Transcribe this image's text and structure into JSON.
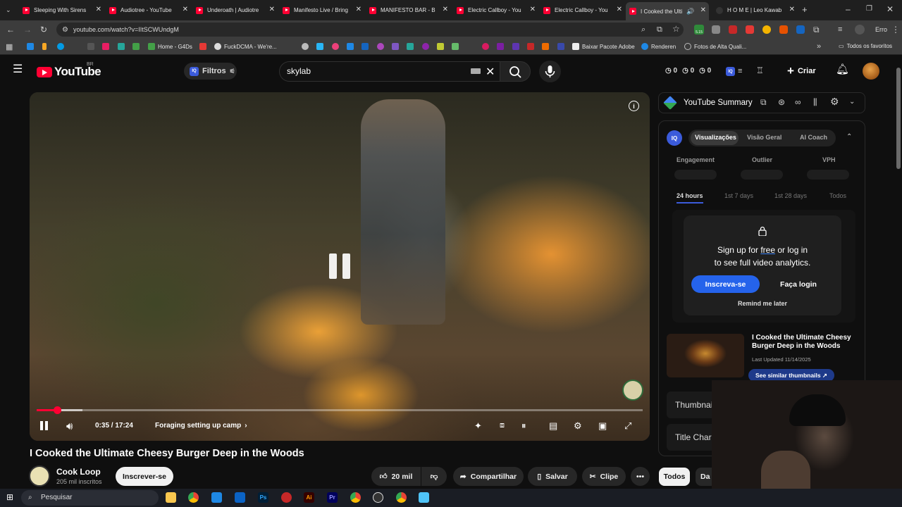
{
  "browser": {
    "tabs": [
      {
        "label": "Sleeping With Sirens",
        "icon": "youtube-favicon"
      },
      {
        "label": "Audiotree - YouTube",
        "icon": "youtube-favicon"
      },
      {
        "label": "Underoath | Audiotre",
        "icon": "youtube-favicon"
      },
      {
        "label": "Manifesto Live / Bring",
        "icon": "youtube-favicon"
      },
      {
        "label": "MANIFESTO BAR - B",
        "icon": "youtube-favicon"
      },
      {
        "label": "Electric Callboy - You",
        "icon": "youtube-favicon"
      },
      {
        "label": "Electric Callboy - You",
        "icon": "youtube-favicon"
      },
      {
        "label": "I Cooked the Ulti",
        "icon": "youtube-favicon"
      },
      {
        "label": "H O M E | Leo Kawab",
        "icon": "page-favicon"
      }
    ],
    "url": "youtube.com/watch?v=IItSCWUndgM",
    "profile_label": "Erro",
    "extension_badge": "5.15",
    "bookmarks": {
      "home": "Home - G4Ds",
      "fuck": "FuckDCMA - We're...",
      "baixar": "Baixar Pacote Adobe",
      "renderen": "Renderen",
      "fotos": "Fotos de Alta Quali...",
      "todos": "Todos os favoritos"
    }
  },
  "youtube": {
    "logo_text": "YouTube",
    "country_code": "BR",
    "filtros_label": "Filtros",
    "filtros_badge": "IQ",
    "search_value": "skylab",
    "counters": [
      "0",
      "0",
      "0"
    ],
    "create_label": "Criar"
  },
  "player": {
    "time": "0:35 / 17:24",
    "chapter": "Foraging setting up camp",
    "progress_fraction": 0.034,
    "buffer_fraction": 0.075
  },
  "video": {
    "title": "I Cooked the Ultimate Cheesy Burger Deep in the Woods",
    "channel": "Cook Loop",
    "subscribers": "205 mil inscritos",
    "subscribe_label": "Inscrever-se",
    "likes": "20 mil",
    "share_label": "Compartilhar",
    "save_label": "Salvar",
    "clip_label": "Clipe"
  },
  "sidebar": {
    "summary_title": "YouTube Summary",
    "iq_logo": "IQ",
    "segments": [
      "Visualizações",
      "Visão Geral",
      "AI Coach"
    ],
    "metrics": [
      "Engagement",
      "Outlier",
      "VPH"
    ],
    "time_ranges": [
      "24 hours",
      "1st 7 days",
      "1st 28 days",
      "Todos"
    ],
    "locked_line1_a": "Sign up for ",
    "locked_line1_free": "free",
    "locked_line1_b": " or log in",
    "locked_line2": "to see full video analytics.",
    "signup_button": "Inscreva-se",
    "login_button": "Faça login",
    "remind_label": "Remind me later",
    "thumb_title": "I Cooked the Ultimate Cheesy Burger Deep in the Woods",
    "thumb_date": "Last Updated 11/14/2025",
    "thumb_button": "See similar thumbnails ↗",
    "row1": "Thumbnai",
    "row2": "Title Char",
    "chip_all": "Todos",
    "chip_next": "Da"
  },
  "taskbar": {
    "search_placeholder": "Pesquisar"
  },
  "colors": {
    "youtube_red": "#ff0033",
    "iq_blue": "#2563eb",
    "background": "#0f0f0f"
  }
}
